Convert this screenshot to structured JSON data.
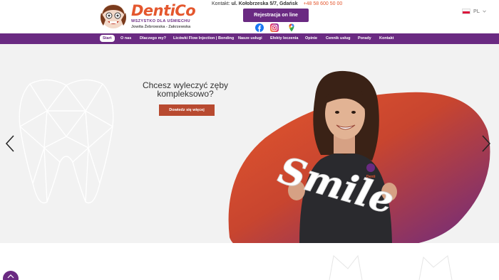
{
  "logo": {
    "word": "DentiCo",
    "tagline": "WSZYSTKO DLA UŚMIECHU",
    "names": "Jowita Żebrowska - Zakrzewska"
  },
  "contact": {
    "label": "Kontakt:",
    "address": "ul. Kołobrzeska 5/7, Gdańsk",
    "phone": "+48 58 600 50 00"
  },
  "register_button": "Rejestracja on line",
  "social": [
    "facebook-icon",
    "instagram-icon",
    "maps-pin-icon"
  ],
  "language": {
    "code": "PL"
  },
  "nav": {
    "items": [
      "Start",
      "O nas",
      "Dlaczego my?",
      "Licówki Flow Injection | Bonding",
      "Nasze usługi",
      "Efekty leczenia",
      "Opinie",
      "Cennik usług",
      "Porady",
      "Kontakt"
    ],
    "active": 0
  },
  "hero": {
    "headline_line1": "Chcesz wyleczyć zęby",
    "headline_line2": "kompleksowo?",
    "button": "Dowiedz się więcej",
    "sign_word": "Smile",
    "shirt_logo": "Denti"
  },
  "colors": {
    "brand_purple": "#6a2a82",
    "brand_orange": "#e4572e",
    "button_red": "#b84a30",
    "hero_bg": "#f2f2f2"
  }
}
